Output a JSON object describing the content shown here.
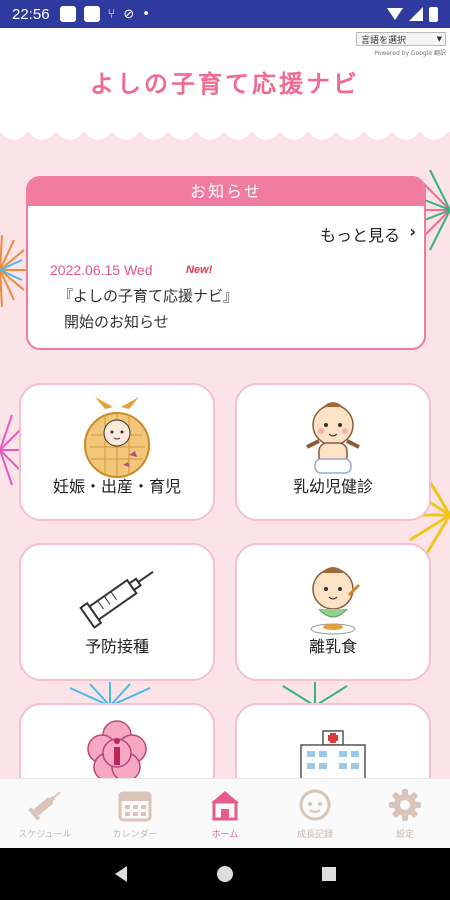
{
  "status_bar": {
    "time": "22:56"
  },
  "header": {
    "language_select": "言語を選択",
    "powered_by": "Powered by Google 翻訳",
    "title": "よしの子育て応援ナビ"
  },
  "news": {
    "heading": "お知らせ",
    "more_link": "もっと見る",
    "items": [
      {
        "date": "2022.06.15 Wed",
        "badge": "New!",
        "line1": "『よしの子育て応援ナビ』",
        "line2": "開始のお知らせ"
      }
    ]
  },
  "menu": [
    {
      "label": "妊娠・出産・育児",
      "icon": "baby-wrap-icon"
    },
    {
      "label": "乳幼児健診",
      "icon": "baby-checkup-icon"
    },
    {
      "label": "予防接種",
      "icon": "syringe-icon"
    },
    {
      "label": "離乳食",
      "icon": "baby-food-icon"
    },
    {
      "label": "",
      "icon": "info-flower-icon"
    },
    {
      "label": "",
      "icon": "hospital-icon"
    }
  ],
  "bottom_nav": [
    {
      "label": "スケジュール",
      "icon": "syringe-nav-icon",
      "active": false
    },
    {
      "label": "カレンダー",
      "icon": "calendar-icon",
      "active": false
    },
    {
      "label": "ホーム",
      "icon": "home-icon",
      "active": true
    },
    {
      "label": "成長記録",
      "icon": "baby-face-icon",
      "active": false
    },
    {
      "label": "設定",
      "icon": "gear-icon",
      "active": false
    }
  ],
  "colors": {
    "accent": "#f07ba0",
    "title": "#f06b92",
    "status_bar": "#2f3a9e",
    "background": "#fbe3e8"
  }
}
